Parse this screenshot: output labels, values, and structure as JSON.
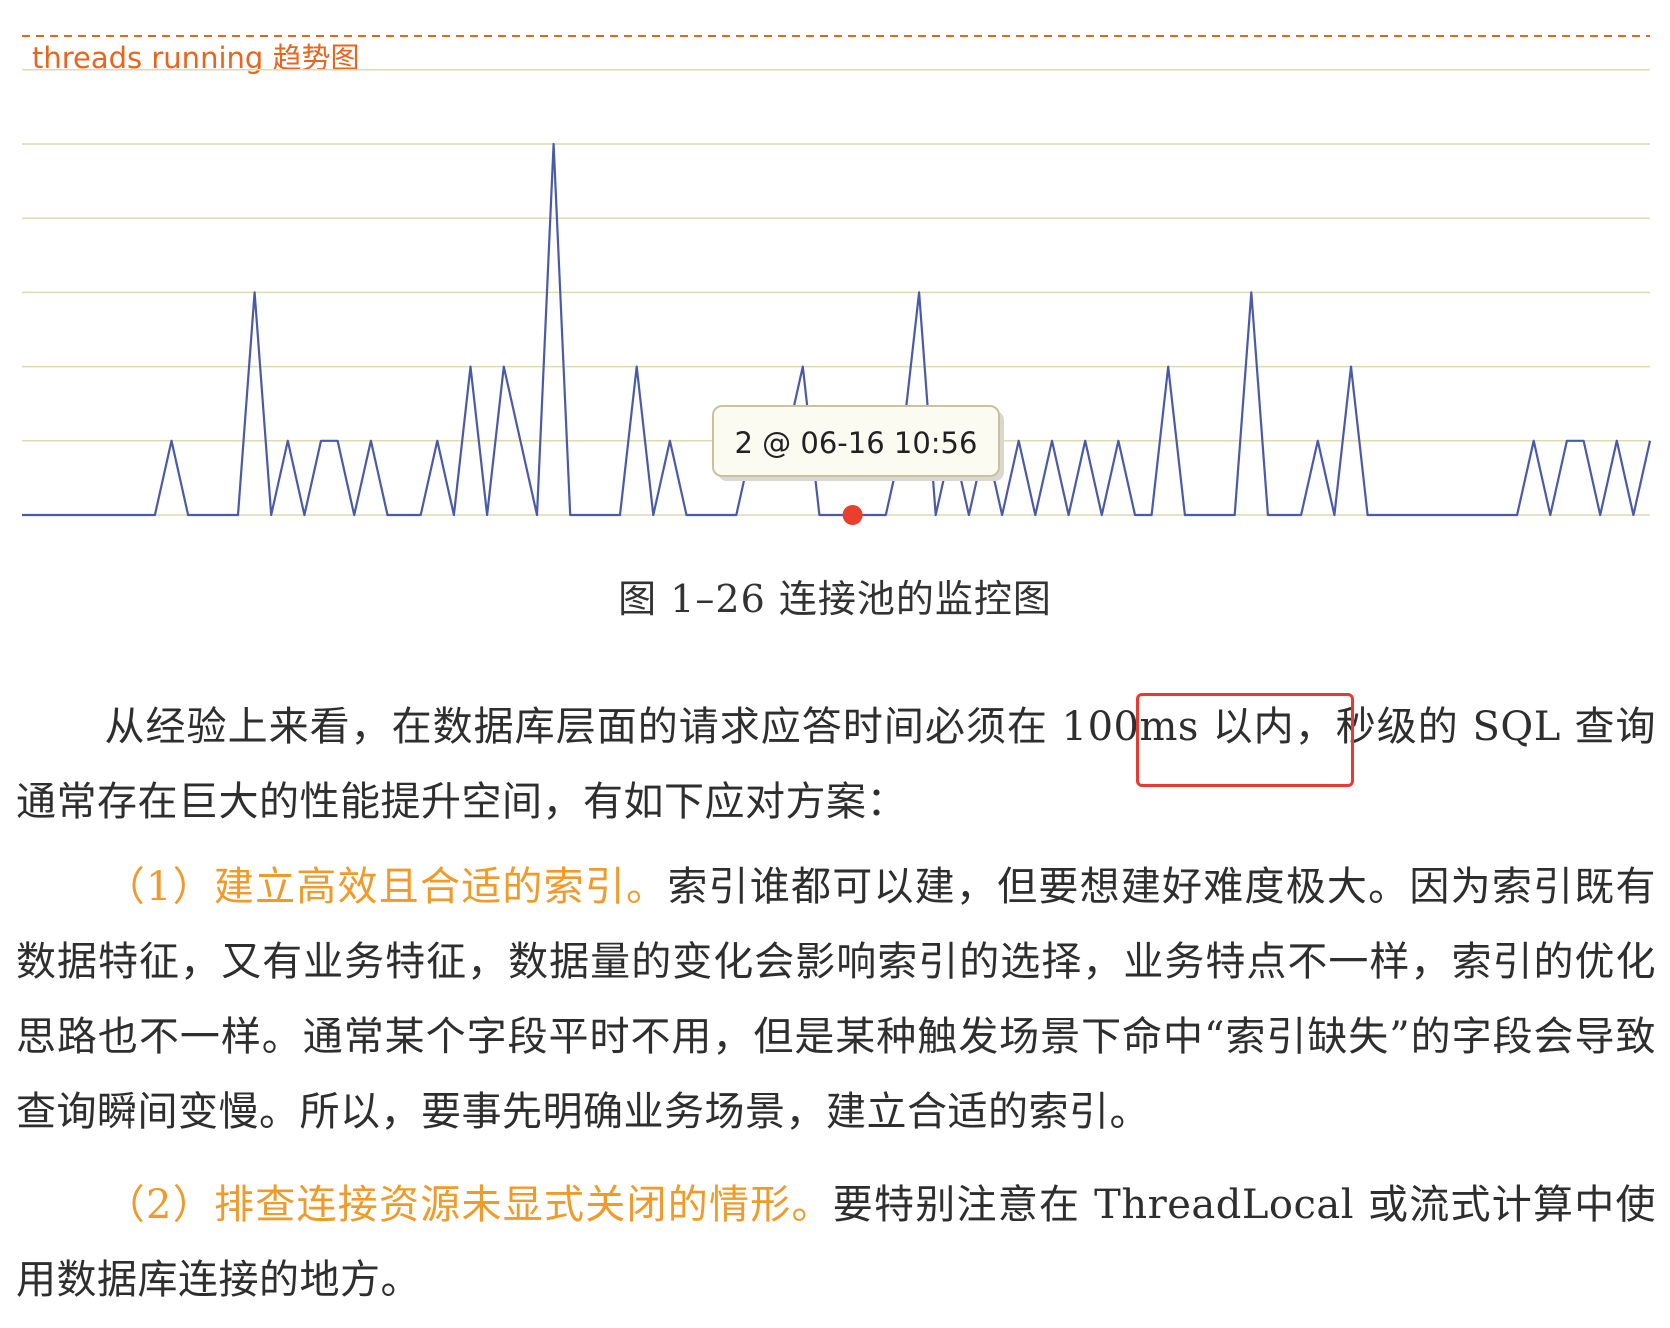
{
  "chart_data": {
    "type": "line",
    "title": "threads running 趋势图",
    "tooltip": "2 @ 06-16 10:56",
    "ylim": [
      0,
      5
    ],
    "grid": true,
    "values": [
      0,
      0,
      0,
      0,
      0,
      0,
      0,
      0,
      0,
      1,
      0,
      0,
      0,
      0,
      3,
      0,
      1,
      0,
      1,
      1,
      0,
      1,
      0,
      0,
      0,
      1,
      0,
      2,
      0,
      2,
      1,
      0,
      5,
      0,
      0,
      0,
      0,
      2,
      0,
      1,
      0,
      0,
      0,
      0,
      1,
      1,
      1,
      2,
      0,
      0,
      0,
      0,
      0,
      1,
      3,
      0,
      1,
      0,
      1,
      0,
      1,
      0,
      1,
      0,
      1,
      0,
      1,
      0,
      0,
      2,
      0,
      0,
      0,
      0,
      3,
      0,
      0,
      0,
      1,
      0,
      2,
      0,
      0,
      0,
      0,
      0,
      0,
      0,
      0,
      0,
      0,
      1,
      0,
      1,
      1,
      0,
      1,
      0,
      1
    ],
    "line_color": "#4a5aa8",
    "marker_index": 50,
    "marker_color": "#e8402b",
    "title_color": "#e8651e"
  },
  "caption": "图 1–26   连接池的监控图",
  "paragraphs": [
    {
      "plain_before": "从经验上来看，在数据库层面的请求应答时间必须在 100ms 以内，秒级的 SQL 查询通常存在巨大的性能提升空间，有如下应对方案："
    },
    {
      "highlight": "（1）建立高效且合适的索引。",
      "body": "索引谁都可以建，但要想建好难度极大。因为索引既有数据特征，又有业务特征，数据量的变化会影响索引的选择，业务特点不一样，索引的优化思路也不一样。通常某个字段平时不用，但是某种触发场景下命中“索引缺失”的字段会导致查询瞬间变慢。所以，要事先明确业务场景，建立合适的索引。"
    },
    {
      "highlight": "（2）排查连接资源未显式关闭的情形。",
      "body": "要特别注意在 ThreadLocal 或流式计算中使用数据库连接的地方。"
    }
  ],
  "colors": {
    "accent_orange": "#f09a2a",
    "box_red": "#e83a32"
  }
}
